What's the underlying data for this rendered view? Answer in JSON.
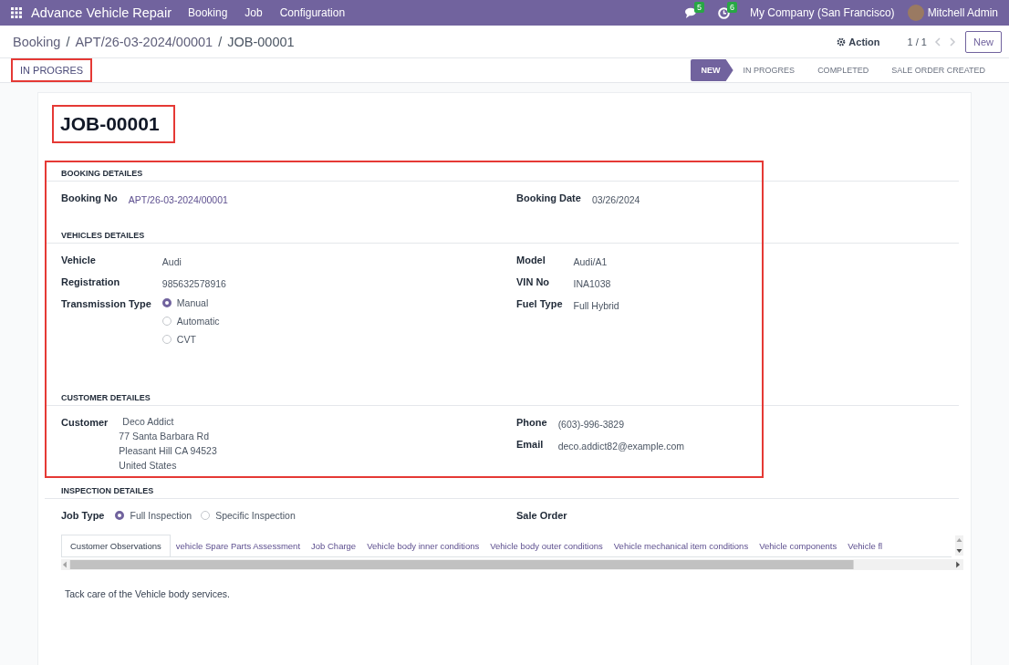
{
  "navbar": {
    "app_name": "Advance Vehicle Repair",
    "menu": [
      "Booking",
      "Job",
      "Configuration"
    ],
    "messages_badge": "5",
    "activities_badge": "6",
    "company": "My Company (San Francisco)",
    "user": "Mitchell Admin"
  },
  "breadcrumbs": [
    "Booking",
    "APT/26-03-2024/00001",
    "JOB-00001"
  ],
  "breadcrumb_separator": "/",
  "action": "Action",
  "pager": "1 / 1",
  "new_button": "New",
  "status_button": {
    "label": "IN PROGRES",
    "highlighted": true
  },
  "stages": [
    {
      "label": "NEW",
      "selected": true
    },
    {
      "label": "IN PROGRES",
      "selected": false
    },
    {
      "label": "COMPLETED",
      "selected": false
    },
    {
      "label": "SALE ORDER CREATED",
      "selected": false
    }
  ],
  "title": {
    "text": "JOB-00001",
    "highlighted": true
  },
  "details_highlighted": true,
  "sections": [
    {
      "title": "BOOKING DETAILES",
      "in_highlight": true,
      "left": [
        {
          "kind": "link",
          "label": "Booking No",
          "value": "APT/26-03-2024/00001"
        }
      ],
      "right": [
        {
          "kind": "text",
          "label": "Booking Date",
          "value": "03/26/2024"
        }
      ]
    },
    {
      "title": "VEHICLES DETAILES",
      "in_highlight": true,
      "left": [
        {
          "kind": "text",
          "label": "Vehicle",
          "value": "Audi"
        },
        {
          "kind": "text",
          "label": "Registration",
          "value": "985632578916"
        },
        {
          "kind": "radio",
          "label": "Transmission Type",
          "options": [
            {
              "label": "Manual",
              "selected": true
            },
            {
              "label": "Automatic",
              "selected": false
            },
            {
              "label": "CVT",
              "selected": false
            }
          ]
        }
      ],
      "right": [
        {
          "kind": "text",
          "label": "Model",
          "value": "Audi/A1"
        },
        {
          "kind": "text",
          "label": "VIN No",
          "value": "INA1038"
        },
        {
          "kind": "text",
          "label": "Fuel Type",
          "value": "Full Hybrid"
        }
      ]
    },
    {
      "title": "CUSTOMER DETAILES",
      "in_highlight": true,
      "left": [
        {
          "kind": "address",
          "label": "Customer",
          "value": "Deco Addict",
          "lines": [
            "77 Santa Barbara Rd",
            "Pleasant Hill CA 94523",
            "United States"
          ]
        }
      ],
      "right": [
        {
          "kind": "text",
          "label": "Phone",
          "value": "(603)-996-3829"
        },
        {
          "kind": "text",
          "label": "Email",
          "value": "deco.addict82@example.com"
        }
      ]
    },
    {
      "title": "INSPECTION DETAILES",
      "in_highlight": false,
      "left": [
        {
          "kind": "radio_inline",
          "label": "Job Type",
          "options": [
            {
              "label": "Full Inspection",
              "selected": true
            },
            {
              "label": "Specific Inspection",
              "selected": false
            }
          ]
        }
      ],
      "right": [
        {
          "kind": "empty",
          "label": "Sale Order"
        }
      ]
    }
  ],
  "tabs": [
    {
      "label": "Customer Observations",
      "selected": true
    },
    {
      "label": "vehicle Spare Parts Assessment",
      "selected": false
    },
    {
      "label": "Job Charge",
      "selected": false
    },
    {
      "label": "Vehicle body inner conditions",
      "selected": false
    },
    {
      "label": "Vehicle body outer conditions",
      "selected": false
    },
    {
      "label": "Vehicle mechanical item conditions",
      "selected": false
    },
    {
      "label": "Vehicle components",
      "selected": false
    },
    {
      "label": "Vehicle fl",
      "selected": false
    }
  ],
  "tab_content": "Tack care of the Vehicle body services."
}
